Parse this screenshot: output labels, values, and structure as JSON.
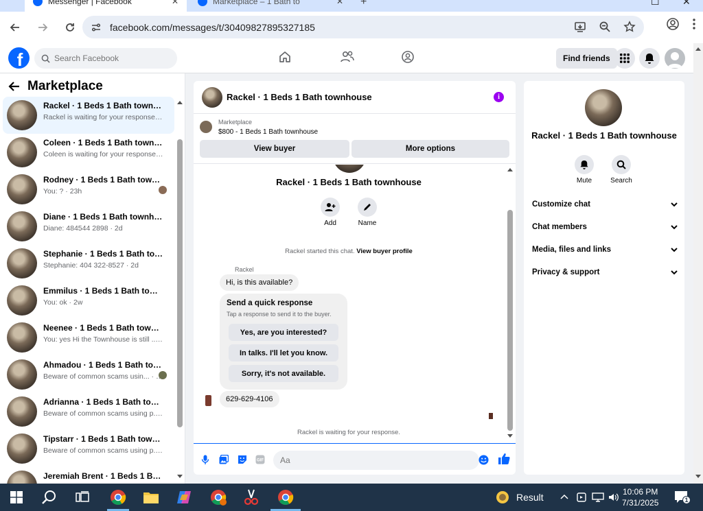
{
  "browser": {
    "tabs": [
      {
        "title": "Messenger | Facebook",
        "active": true
      },
      {
        "title": "Marketplace – 1 Bath to",
        "active": false
      }
    ],
    "url": "facebook.com/messages/t/30409827895327185"
  },
  "fb_header": {
    "search_placeholder": "Search Facebook",
    "find_friends_label": "Find friends"
  },
  "sidebar": {
    "title": "Marketplace",
    "conversations": [
      {
        "name": "Rackel · 1 Beds 1 Bath townhouse",
        "preview": "Rackel is waiting for your response. · 2h",
        "selected": true,
        "seen": false
      },
      {
        "name": "Coleen · 1 Beds 1 Bath townhouse",
        "preview": "Coleen is waiting for your response. · 7h",
        "selected": false,
        "seen": false
      },
      {
        "name": "Rodney · 1 Beds 1 Bath townh...",
        "preview": "You: ? · 23h",
        "selected": false,
        "seen": true
      },
      {
        "name": "Diane · 1 Beds 1 Bath townhouse",
        "preview": "Diane: 484544 2898 · 2d",
        "selected": false,
        "seen": false
      },
      {
        "name": "Stephanie · 1 Beds 1 Bath townh...",
        "preview": "Stephanie: 404 322-8527 · 2d",
        "selected": false,
        "seen": false
      },
      {
        "name": "Emmilus · 1 Beds 1 Bath townho...",
        "preview": "You: ok · 2w",
        "selected": false,
        "seen": false
      },
      {
        "name": "Neenee · 1 Beds 1 Bath townho...",
        "preview": "You: yes Hi the Townhouse is still ... · 2w",
        "selected": false,
        "seen": false
      },
      {
        "name": "Ahmadou · 1 Beds 1 Bath tow...",
        "preview": "Beware of common scams usin... · 3w",
        "selected": false,
        "seen": true
      },
      {
        "name": "Adrianna · 1 Beds 1 Bath townh...",
        "preview": "Beware of common scams using p... · 3w",
        "selected": false,
        "seen": false
      },
      {
        "name": "Tipstarr · 1 Beds 1 Bath townho...",
        "preview": "Beware of common scams using p... · 3w",
        "selected": false,
        "seen": false
      },
      {
        "name": "Jeremiah Brent · 1 Beds 1 Bath t...",
        "preview": "",
        "selected": false,
        "seen": false
      }
    ]
  },
  "chat": {
    "header_title": "Rackel · 1 Beds 1 Bath townhouse",
    "marketplace_label": "Marketplace",
    "listing": "$800 - 1 Beds 1 Bath townhouse",
    "view_buyer_label": "View buyer",
    "more_options_label": "More options",
    "profile_name": "Rackel · 1 Beds 1 Bath townhouse",
    "add_label": "Add",
    "name_label": "Name",
    "started_text": "Rackel started this chat.",
    "view_profile_link": "View buyer profile",
    "sender_name": "Rackel",
    "first_message": "Hi, is this available?",
    "quick_title": "Send a quick response",
    "quick_sub": "Tap a response to send it to the buyer.",
    "quick_replies": [
      "Yes, are you interested?",
      "In talks. I'll let you know.",
      "Sorry, it's not available."
    ],
    "phone_message": "629-629-4106",
    "waiting_text": "Rackel is waiting for your response.",
    "composer_placeholder": "Aa"
  },
  "right_panel": {
    "name": "Rackel · 1 Beds 1 Bath townhouse",
    "mute_label": "Mute",
    "search_label": "Search",
    "sections": [
      "Customize chat",
      "Chat members",
      "Media, files and links",
      "Privacy & support"
    ]
  },
  "taskbar": {
    "result_label": "Result",
    "time": "10:06 PM",
    "date": "7/31/2025",
    "notification_count": "1"
  },
  "colors": {
    "fb_blue": "#0866ff",
    "info_purple": "#9b00f0",
    "taskbar_bg": "#1f3348"
  }
}
